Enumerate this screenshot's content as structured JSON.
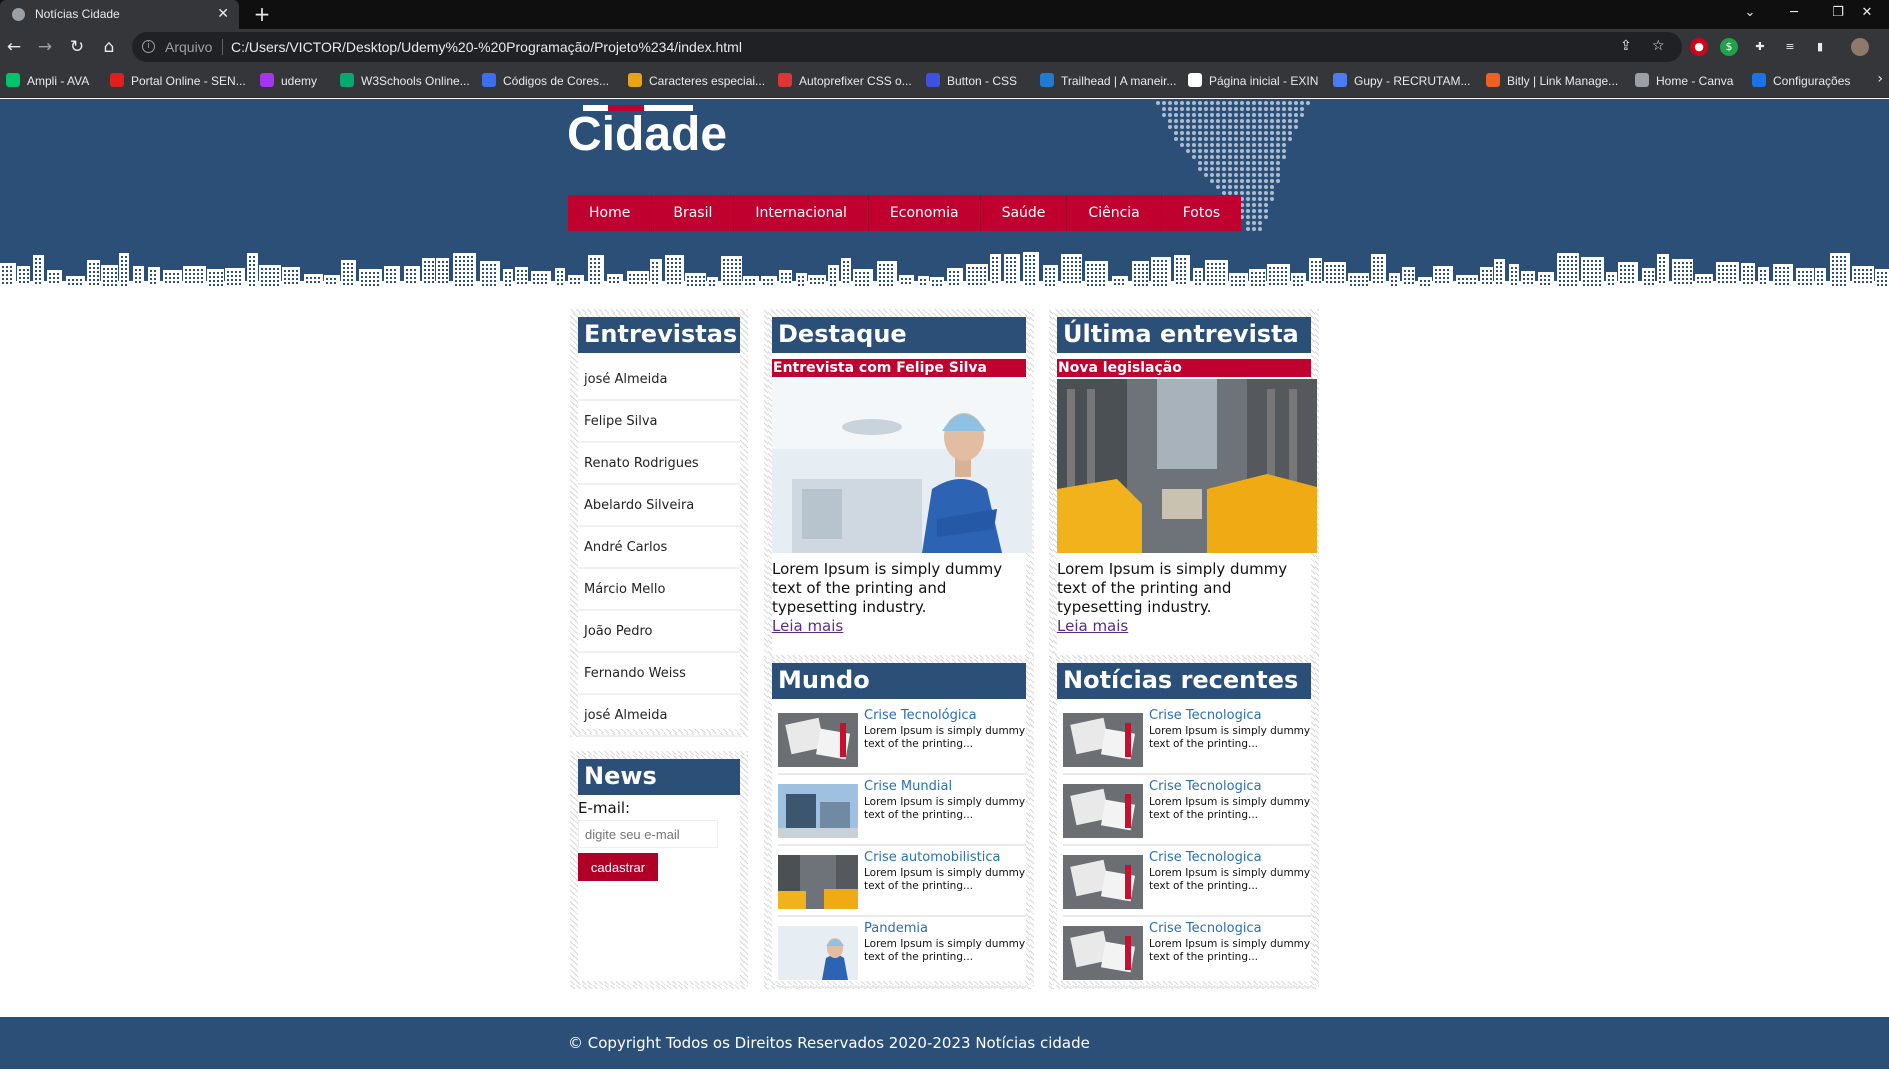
{
  "browser": {
    "tab_title": "Notícias Cidade",
    "address_scheme": "Arquivo",
    "url": "C:/Users/VICTOR/Desktop/Udemy%20-%20Programação/Projeto%234/index.html",
    "bookmarks": [
      {
        "label": "Ampli - AVA",
        "color": "#00c46a"
      },
      {
        "label": "Portal Online - SEN...",
        "color": "#e0201e"
      },
      {
        "label": "udemy",
        "color": "#a435f0"
      },
      {
        "label": "W3Schools Online...",
        "color": "#04aa6d"
      },
      {
        "label": "Códigos de Cores...",
        "color": "#3b6ff0"
      },
      {
        "label": "Caracteres especiai...",
        "color": "#e8a317"
      },
      {
        "label": "Autoprefixer CSS o...",
        "color": "#dd3735"
      },
      {
        "label": "Button - CSS",
        "color": "#3f51e0"
      },
      {
        "label": "Trailhead | A maneir...",
        "color": "#1f7bd1"
      },
      {
        "label": "Página inicial - EXIN",
        "color": "#ffffff"
      },
      {
        "label": "Gupy - RECRUTAM...",
        "color": "#4c7cf3"
      },
      {
        "label": "Bitly | Link Manage...",
        "color": "#ee6123"
      },
      {
        "label": "Home - Canva",
        "color": "#9aa0a6"
      },
      {
        "label": "Configurações",
        "color": "#1a73e8"
      }
    ]
  },
  "site": {
    "logo": "Cidade",
    "menu": [
      "Home",
      "Brasil",
      "Internacional",
      "Economia",
      "Saúde",
      "Ciência",
      "Fotos"
    ]
  },
  "entrevistas": {
    "title": "Entrevistas",
    "items": [
      "josé Almeida",
      "Felipe Silva",
      "Renato Rodrigues",
      "Abelardo Silveira",
      "André Carlos",
      "Márcio Mello",
      "João Pedro",
      "Fernando Weiss",
      "josé Almeida"
    ]
  },
  "news": {
    "title": "News",
    "email_label": "E-mail:",
    "email_placeholder": "digite seu e-mail",
    "button": "cadastrar"
  },
  "destaque": {
    "title": "Destaque",
    "subtitle": "Entrevista com Felipe Silva",
    "text": "Lorem Ipsum is simply dummy text of the printing and typesetting industry.",
    "link": "Leia mais"
  },
  "ultima": {
    "title": "Última entrevista",
    "subtitle": "Nova legislação",
    "text": "Lorem Ipsum is simply dummy text of the printing and typesetting industry.",
    "link": "Leia mais"
  },
  "mundo": {
    "title": "Mundo",
    "items": [
      {
        "title": "Crise Tecnológica",
        "desc": "Lorem Ipsum is simply dummy text of the printing...",
        "thumb": "desk"
      },
      {
        "title": "Crise Mundial",
        "desc": "Lorem Ipsum is simply dummy text of the printing...",
        "thumb": "building"
      },
      {
        "title": "Crise automobilistica",
        "desc": "Lorem Ipsum is simply dummy text of the printing...",
        "thumb": "taxi"
      },
      {
        "title": "Pandemia",
        "desc": "Lorem Ipsum is simply dummy text of the printing...",
        "thumb": "doctor"
      }
    ]
  },
  "recentes": {
    "title": "Notícias recentes",
    "items": [
      {
        "title": "Crise Tecnologica",
        "desc": "Lorem Ipsum is simply dummy text of the printing...",
        "thumb": "desk"
      },
      {
        "title": "Crise Tecnologica",
        "desc": "Lorem Ipsum is simply dummy text of the printing...",
        "thumb": "desk"
      },
      {
        "title": "Crise Tecnologica",
        "desc": "Lorem Ipsum is simply dummy text of the printing...",
        "thumb": "desk"
      },
      {
        "title": "Crise Tecnologica",
        "desc": "Lorem Ipsum is simply dummy text of the printing...",
        "thumb": "desk"
      }
    ]
  },
  "footer": {
    "text": "© Copyright Todos os Direitos Reservados 2020-2023 Notícias cidade"
  },
  "colors": {
    "header_blue": "#2b4f77",
    "accent_red": "#c0002e",
    "link_blue": "#2a6fb3",
    "visited_link": "#5a2d8c"
  }
}
